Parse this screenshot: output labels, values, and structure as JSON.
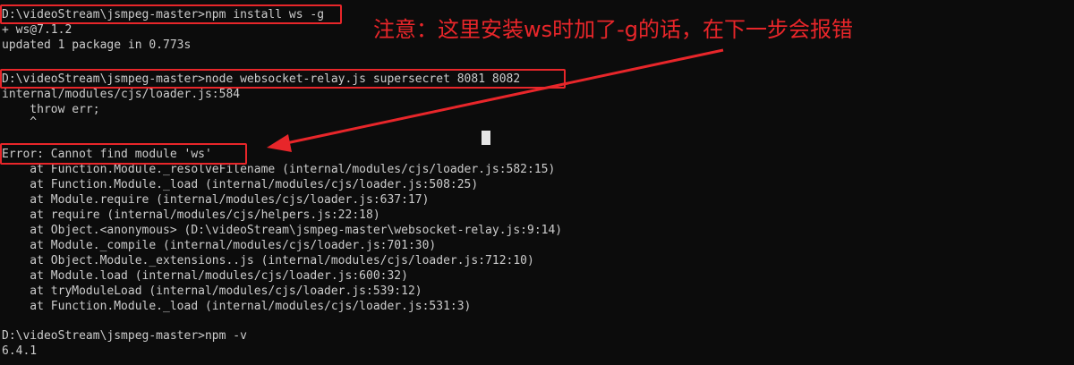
{
  "terminal": {
    "lines": [
      "D:\\videoStream\\jsmpeg-master>npm install ws -g",
      "+ ws@7.1.2",
      "updated 1 package in 0.773s",
      "",
      "D:\\videoStream\\jsmpeg-master>node websocket-relay.js supersecret 8081 8082",
      "internal/modules/cjs/loader.js:584",
      "    throw err;",
      "    ^",
      "",
      "Error: Cannot find module 'ws'",
      "    at Function.Module._resolveFilename (internal/modules/cjs/loader.js:582:15)",
      "    at Function.Module._load (internal/modules/cjs/loader.js:508:25)",
      "    at Module.require (internal/modules/cjs/loader.js:637:17)",
      "    at require (internal/modules/cjs/helpers.js:22:18)",
      "    at Object.<anonymous> (D:\\videoStream\\jsmpeg-master\\websocket-relay.js:9:14)",
      "    at Module._compile (internal/modules/cjs/loader.js:701:30)",
      "    at Object.Module._extensions..js (internal/modules/cjs/loader.js:712:10)",
      "    at Module.load (internal/modules/cjs/loader.js:600:32)",
      "    at tryModuleLoad (internal/modules/cjs/loader.js:539:12)",
      "    at Function.Module._load (internal/modules/cjs/loader.js:531:3)",
      "",
      "D:\\videoStream\\jsmpeg-master>npm -v",
      "6.4.1"
    ]
  },
  "annotation": {
    "text": "注意：这里安装ws时加了-g的话，在下一步会报错"
  },
  "colors": {
    "background": "#0c0c0c",
    "text": "#cccccc",
    "highlight": "#e8262a"
  }
}
